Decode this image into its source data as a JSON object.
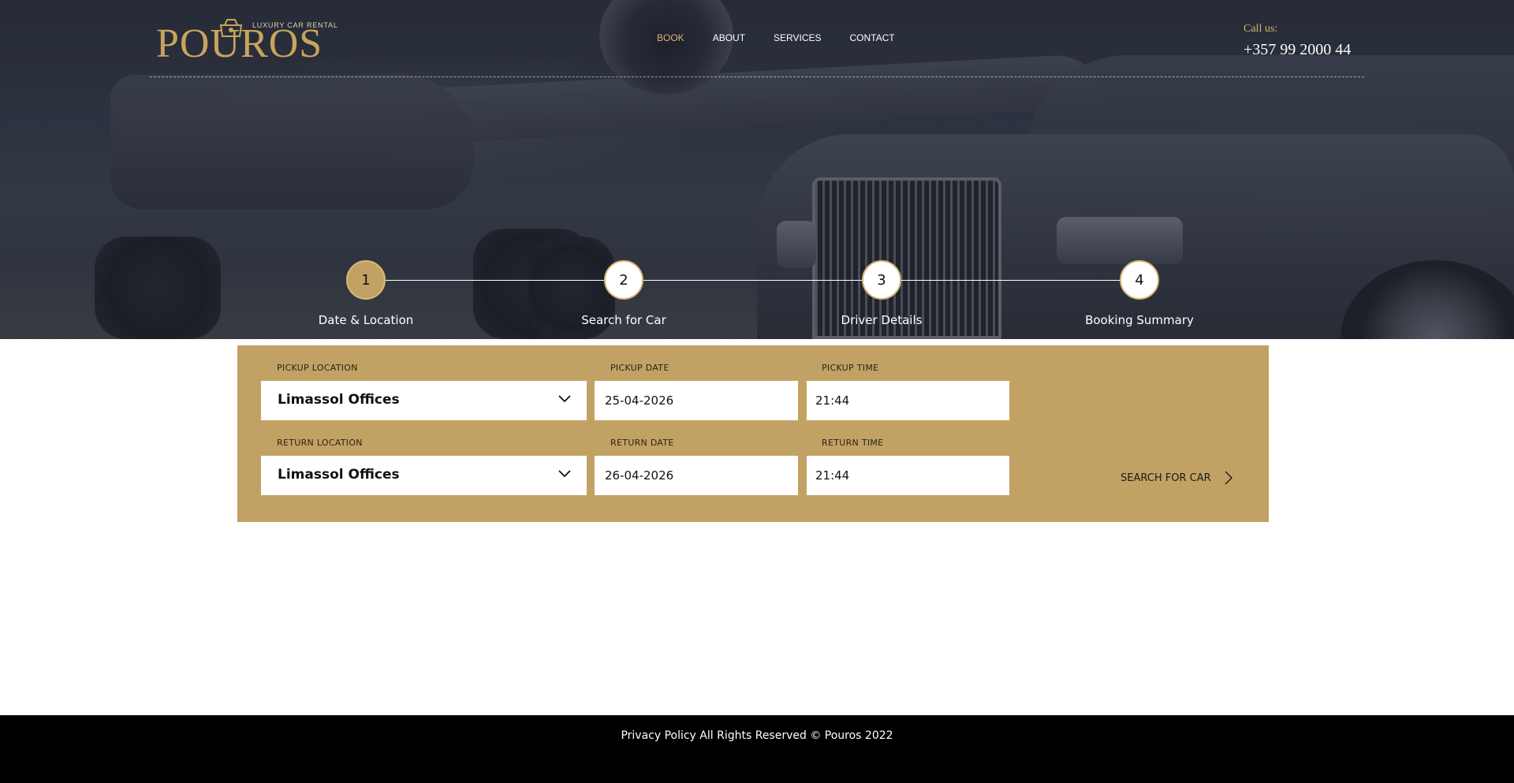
{
  "brand": {
    "logo_text": "POUROS",
    "tagline": "LUXURY CAR RENTAL",
    "gold": "#c2a264",
    "accent_text": "#d8b775"
  },
  "nav": {
    "items": [
      {
        "label": "BOOK",
        "active": true
      },
      {
        "label": "ABOUT",
        "active": false
      },
      {
        "label": "SERVICES",
        "active": false
      },
      {
        "label": "CONTACT",
        "active": false
      }
    ]
  },
  "contact": {
    "label": "Call us:",
    "phone": "+357 99 2000 44"
  },
  "steps": [
    {
      "number": "1",
      "label": "Date & Location",
      "active": true
    },
    {
      "number": "2",
      "label": "Search for Car",
      "active": false
    },
    {
      "number": "3",
      "label": "Driver Details",
      "active": false
    },
    {
      "number": "4",
      "label": "Booking Summary",
      "active": false
    }
  ],
  "form": {
    "pickup_location_label": "PICKUP LOCATION",
    "pickup_location_value": "Limassol Offices",
    "pickup_date_label": "PICKUP DATE",
    "pickup_date_value": "25-04-2026",
    "pickup_time_label": "PICKUP TIME",
    "pickup_time_value": "21:44",
    "return_location_label": "RETURN LOCATION",
    "return_location_value": "Limassol Offices",
    "return_date_label": "RETURN DATE",
    "return_date_value": "26-04-2026",
    "return_time_label": "RETURN TIME",
    "return_time_value": "21:44",
    "search_button_label": "SEARCH FOR CAR"
  },
  "footer": {
    "text": "Privacy Policy All Rights Reserved © Pouros 2022"
  }
}
